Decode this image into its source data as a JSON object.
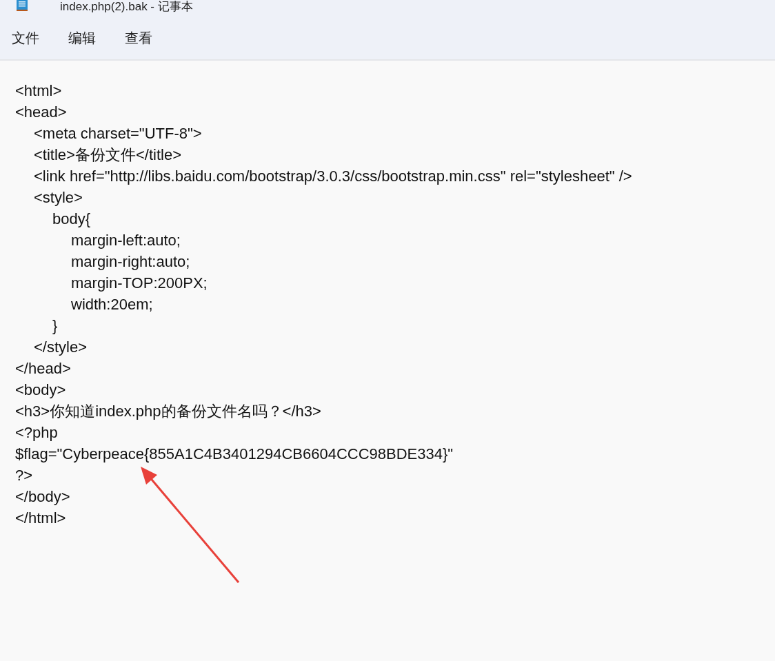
{
  "window": {
    "title": "index.php(2).bak - 记事本"
  },
  "menu": [
    {
      "label": "文件"
    },
    {
      "label": "编辑"
    },
    {
      "label": "查看"
    }
  ],
  "lines": [
    {
      "text": "<html>"
    },
    {
      "text": "<head>",
      "children": [
        {
          "text": "<meta charset=\"UTF-8\">"
        },
        {
          "text": "<title>备份文件</title>"
        },
        {
          "text": "<link href=\"http://libs.baidu.com/bootstrap/3.0.3/css/bootstrap.min.css\" rel=\"stylesheet\" />"
        },
        {
          "text": "<style>",
          "children": [
            {
              "text": "body{",
              "children": [
                {
                  "text": "margin-left:auto;"
                },
                {
                  "text": "margin-right:auto;"
                },
                {
                  "text": "margin-TOP:200PX;"
                },
                {
                  "text": "width:20em;"
                }
              ]
            },
            {
              "text": "}"
            }
          ]
        },
        {
          "text": "</style>"
        }
      ]
    },
    {
      "text": "</head>"
    },
    {
      "text": "<body>"
    },
    {
      "text": "<h3>你知道index.php的备份文件名吗？</h3>"
    },
    {
      "text": "<?php"
    },
    {
      "text": "$flag=\"Cyberpeace{855A1C4B3401294CB6604CCC98BDE334}\""
    },
    {
      "text": "?>"
    },
    {
      "text": "</body>"
    },
    {
      "text": "</html>"
    }
  ]
}
